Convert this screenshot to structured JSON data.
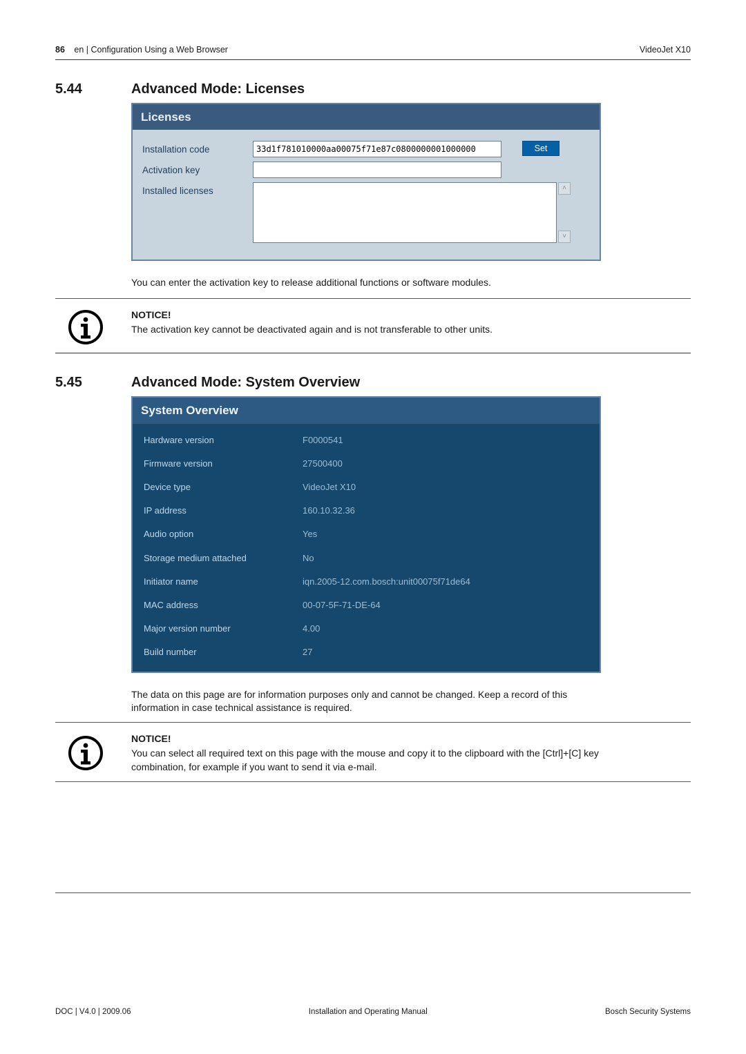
{
  "header": {
    "page_number": "86",
    "breadcrumb": "en | Configuration Using a Web Browser",
    "product": "VideoJet X10"
  },
  "section544": {
    "num": "5.44",
    "title": "Advanced Mode: Licenses",
    "panel_title": "Licenses",
    "rows": {
      "installation_code_label": "Installation code",
      "installation_code_value": "33d1f781010000aa00075f71e87c0800000001000000",
      "set_btn": "Set",
      "activation_key_label": "Activation key",
      "activation_key_value": "",
      "installed_licenses_label": "Installed licenses",
      "installed_licenses_value": ""
    },
    "para": "You can enter the activation key to release additional functions or software modules.",
    "notice_heading": "NOTICE!",
    "notice_text": "The activation key cannot be deactivated again and is not transferable to other units."
  },
  "section545": {
    "num": "5.45",
    "title": "Advanced Mode: System Overview",
    "panel_title": "System Overview",
    "rows": [
      {
        "label": "Hardware version",
        "value": "F0000541"
      },
      {
        "label": "Firmware version",
        "value": "27500400"
      },
      {
        "label": "Device type",
        "value": "VideoJet X10"
      },
      {
        "label": "IP address",
        "value": "160.10.32.36"
      },
      {
        "label": "Audio option",
        "value": "Yes"
      },
      {
        "label": "Storage medium attached",
        "value": "No"
      },
      {
        "label": "Initiator name",
        "value": "iqn.2005-12.com.bosch:unit00075f71de64"
      },
      {
        "label": "MAC address",
        "value": "00-07-5F-71-DE-64"
      },
      {
        "label": "Major version number",
        "value": "4.00"
      },
      {
        "label": "Build number",
        "value": "27"
      }
    ],
    "para": "The data on this page are for information purposes only and cannot be changed. Keep a record of this information in case technical assistance is required.",
    "notice_heading": "NOTICE!",
    "notice_text": "You can select all required text on this page with the mouse and copy it to the clipboard with the [Ctrl]+[C] key combination, for example if you want to send it via e-mail."
  },
  "footer": {
    "left": "DOC | V4.0 | 2009.06",
    "center": "Installation and Operating Manual",
    "right": "Bosch Security Systems"
  }
}
